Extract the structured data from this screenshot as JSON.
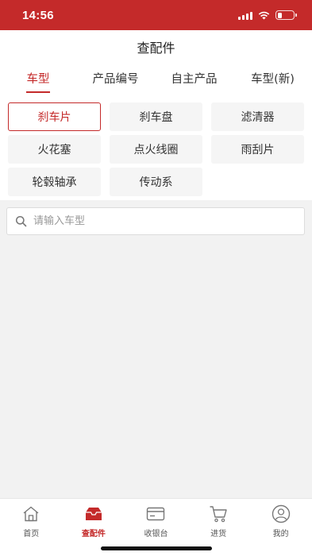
{
  "status_bar": {
    "time": "14:56"
  },
  "header": {
    "title": "查配件"
  },
  "tabs": [
    {
      "label": "车型",
      "active": true
    },
    {
      "label": "产品编号",
      "active": false
    },
    {
      "label": "自主产品",
      "active": false
    },
    {
      "label": "车型(新)",
      "active": false
    }
  ],
  "categories": [
    {
      "label": "刹车片",
      "selected": true
    },
    {
      "label": "刹车盘",
      "selected": false
    },
    {
      "label": "滤清器",
      "selected": false
    },
    {
      "label": "火花塞",
      "selected": false
    },
    {
      "label": "点火线圈",
      "selected": false
    },
    {
      "label": "雨刮片",
      "selected": false
    },
    {
      "label": "轮毂轴承",
      "selected": false
    },
    {
      "label": "传动系",
      "selected": false
    }
  ],
  "search": {
    "placeholder": "请输入车型",
    "value": ""
  },
  "tabbar": [
    {
      "label": "首页",
      "icon": "home-icon",
      "active": false
    },
    {
      "label": "查配件",
      "icon": "box-icon",
      "active": true
    },
    {
      "label": "收银台",
      "icon": "card-icon",
      "active": false
    },
    {
      "label": "进货",
      "icon": "cart-icon",
      "active": false
    },
    {
      "label": "我的",
      "icon": "user-icon",
      "active": false
    }
  ],
  "colors": {
    "accent": "#c42a2a",
    "background": "#f2f2f2"
  }
}
